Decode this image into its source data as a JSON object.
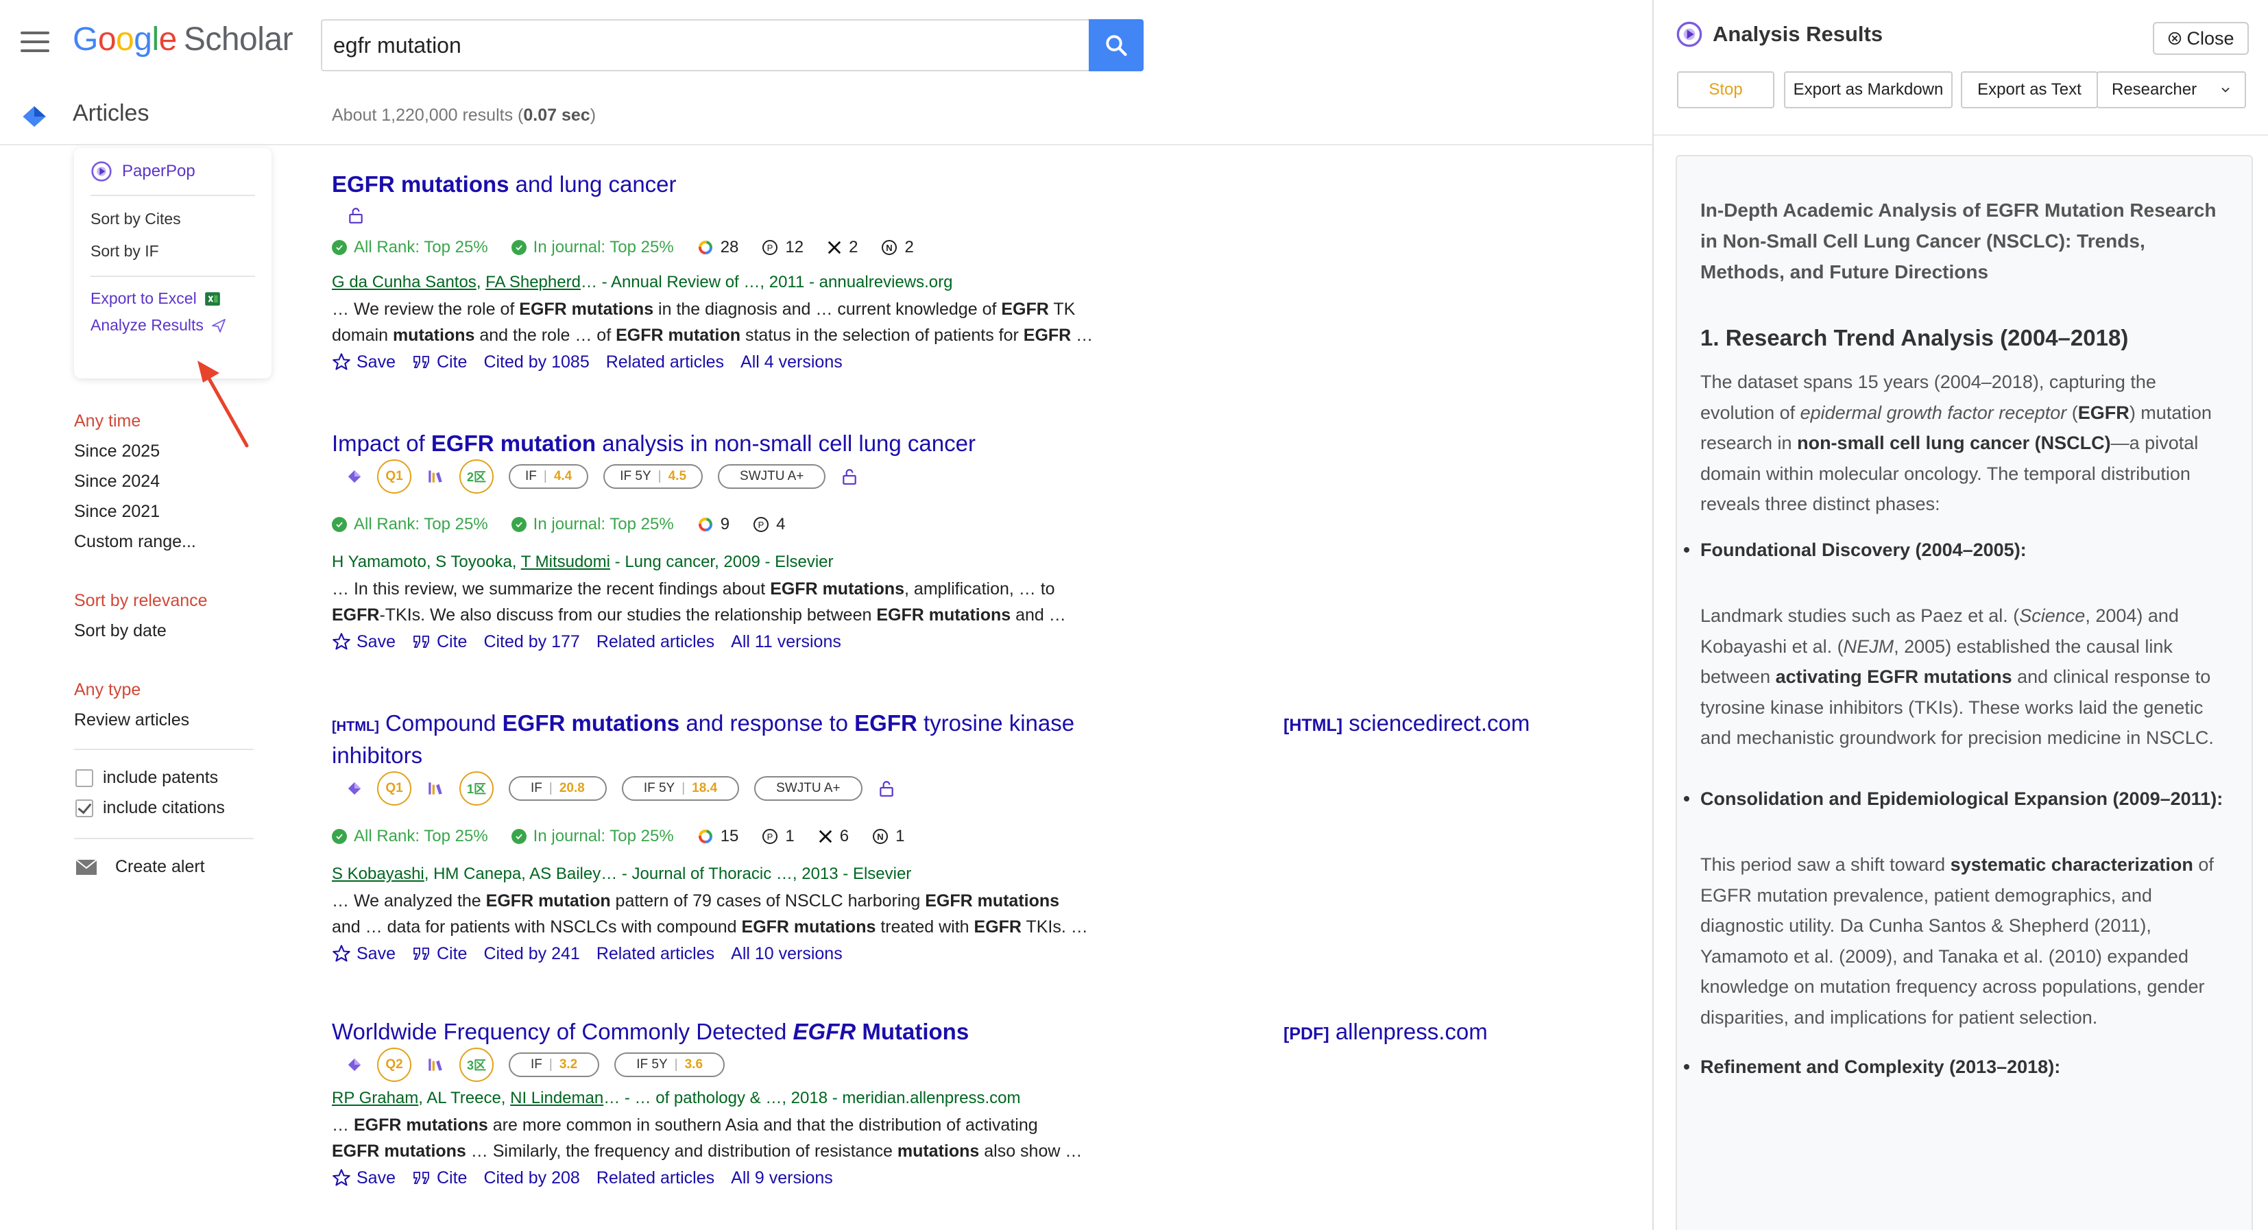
{
  "scholar": {
    "logo_letters": [
      "G",
      "o",
      "o",
      "g",
      "l",
      "e"
    ],
    "logo_suffix": "Scholar",
    "search": {
      "value": "egfr mutation"
    },
    "section_label": "Articles",
    "results_count_prefix": "About 1,220,000 results (",
    "results_count_time": "0.07 sec",
    "results_count_suffix": ")"
  },
  "paperpop": {
    "title": "PaperPop",
    "sort_cites": "Sort by Cites",
    "sort_if": "Sort by IF",
    "export_excel": "Export to Excel",
    "analyze": "Analyze Results"
  },
  "sidebar": {
    "time": [
      "Any time",
      "Since 2025",
      "Since 2024",
      "Since 2021",
      "Custom range..."
    ],
    "sort": [
      "Sort by relevance",
      "Sort by date"
    ],
    "type": [
      "Any type",
      "Review articles"
    ],
    "include_patents": "include patents",
    "include_citations": "include citations",
    "create_alert": "Create alert"
  },
  "common": {
    "save": "Save",
    "cite": "Cite",
    "related": "Related articles",
    "all_rank": "All Rank: Top 25%",
    "in_journal": "In journal: Top 25%",
    "if_label": "IF",
    "if5_label": "IF 5Y",
    "swjtu": "SWJTU A+"
  },
  "results": [
    {
      "title_a": "EGFR mutations",
      "title_b": " and lung cancer",
      "stats": {
        "google": "28",
        "p": "12",
        "x": "2",
        "n": "2"
      },
      "authors_1": "G da Cunha Santos",
      "authors_sep1": ", ",
      "authors_2": "FA Shepherd",
      "authors_rest": "… - Annual Review of …, 2011 - annualreviews.org",
      "snip_1": "… We review the role of ",
      "snip_2": "EGFR mutations",
      "snip_3": " in the diagnosis and … current knowledge of ",
      "snip_4": "EGFR",
      "snip_5": " TK",
      "snip_6": "domain ",
      "snip_7": "mutations",
      "snip_8": " and the role … of ",
      "snip_9": "EGFR mutation",
      "snip_10": " status in the selection of patients for ",
      "snip_11": "EGFR",
      "snip_12": " …",
      "cited": "Cited by 1085",
      "versions": "All 4 versions"
    },
    {
      "title_a": "Impact of ",
      "title_b": "EGFR mutation",
      "title_c": " analysis in non-small cell lung cancer",
      "q": "Q1",
      "zone": "2区",
      "if": "4.4",
      "if5": "4.5",
      "stats": {
        "google": "9",
        "p": "4"
      },
      "authors_1": "H Yamamoto, S Toyooka, ",
      "authors_2": "T Mitsudomi",
      "authors_rest": " - Lung cancer, 2009 - Elsevier",
      "snip_1": "… In this review, we summarize the recent findings about ",
      "snip_2": "EGFR mutations",
      "snip_3": ", amplification, … to",
      "snip_4": "EGFR",
      "snip_5": "-TKIs. We also discuss from our studies the relationship between ",
      "snip_6": "EGFR mutations",
      "snip_7": " and …",
      "cited": "Cited by 177",
      "versions": "All 11 versions"
    },
    {
      "tag": "[HTML]",
      "title_a": " Compound ",
      "title_b": "EGFR mutations",
      "title_c": " and response to ",
      "title_d": "EGFR",
      "title_e": " tyrosine kinase",
      "title_f": "inhibitors",
      "q": "Q1",
      "zone": "1区",
      "if": "20.8",
      "if5": "18.4",
      "stats": {
        "google": "15",
        "p": "1",
        "x": "6",
        "n": "1"
      },
      "side_tag": "[HTML]",
      "side_link": "sciencedirect.com",
      "authors_1": "S Kobayashi",
      "authors_rest": ", HM Canepa, AS Bailey… - Journal of Thoracic …, 2013 - Elsevier",
      "snip_1": "… We analyzed the ",
      "snip_2": "EGFR mutation",
      "snip_3": " pattern of 79 cases of NSCLC harboring ",
      "snip_4": "EGFR mutations",
      "snip_5": "and … data for patients with NSCLCs with compound ",
      "snip_6": "EGFR mutations",
      "snip_7": " treated with ",
      "snip_8": "EGFR",
      "snip_9": " TKIs. …",
      "cited": "Cited by 241",
      "versions": "All 10 versions"
    },
    {
      "title_a": "Worldwide Frequency of Commonly Detected ",
      "title_b": "EGFR",
      "title_c": " Mutations",
      "q": "Q2",
      "zone": "3区",
      "if": "3.2",
      "if5": "3.6",
      "side_tag": "[PDF]",
      "side_link": "allenpress.com",
      "authors_1": "RP Graham",
      "authors_2": ", AL Treece, ",
      "authors_3": "NI Lindeman",
      "authors_rest": "… - … of pathology & …, 2018 - meridian.allenpress.com",
      "snip_1": "… ",
      "snip_2": "EGFR mutations",
      "snip_3": " are more common in southern Asia and that the distribution of activating",
      "snip_4": "EGFR mutations",
      "snip_5": " … Similarly, the frequency and distribution of resistance ",
      "snip_6": "mutations",
      "snip_7": " also show …",
      "cited": "Cited by 208",
      "versions": "All 9 versions"
    }
  ],
  "panel": {
    "title": "Analysis Results",
    "close": "Close",
    "stop": "Stop",
    "export_md": "Export as Markdown",
    "export_txt": "Export as Text",
    "role": "Researcher",
    "doc_title": "In-Depth Academic Analysis of EGFR Mutation Research in Non-Small Cell Lung Cancer (NSCLC): Trends, Methods, and Future Directions",
    "h2": "1. Research Trend Analysis (2004–2018)",
    "intro_1": "The dataset spans 15 years (2004–2018), capturing the evolution of ",
    "intro_2": "epidermal growth factor receptor",
    "intro_3": " (",
    "intro_4": "EGFR",
    "intro_5": ") mutation research in ",
    "intro_6": "non-small cell lung cancer (NSCLC)",
    "intro_7": "—a pivotal domain within molecular oncology. The temporal distribution reveals three distinct phases:",
    "li1": "Foundational Discovery (2004–2005):",
    "li1_t1": "Landmark studies such as Paez et al. (",
    "li1_t2": "Science",
    "li1_t3": ", 2004) and Kobayashi et al. (",
    "li1_t4": "NEJM",
    "li1_t5": ", 2005) established the causal link between ",
    "li1_t6": "activating EGFR mutations",
    "li1_t7": " and clinical response to tyrosine kinase inhibitors (TKIs). These works laid the genetic and mechanistic groundwork for precision medicine in NSCLC.",
    "li2": "Consolidation and Epidemiological Expansion (2009–2011):",
    "li2_t1": "This period saw a shift toward ",
    "li2_t2": "systematic characterization",
    "li2_t3": " of EGFR mutation prevalence, patient demographics, and diagnostic utility. Da Cunha Santos & Shepherd (2011), Yamamoto et al. (2009), and Tanaka et al. (2010) expanded knowledge on mutation frequency across populations, gender disparities, and implications for patient selection.",
    "li3": "Refinement and Complexity (2013–2018):"
  },
  "colors": {
    "link": "#1a0dab",
    "green": "#3aa64b",
    "author_green": "#006621",
    "accent_red": "#d14836",
    "paperpop_purple": "#5b34c9",
    "search_blue": "#4285f4",
    "badge_gold": "#e3a21a"
  }
}
